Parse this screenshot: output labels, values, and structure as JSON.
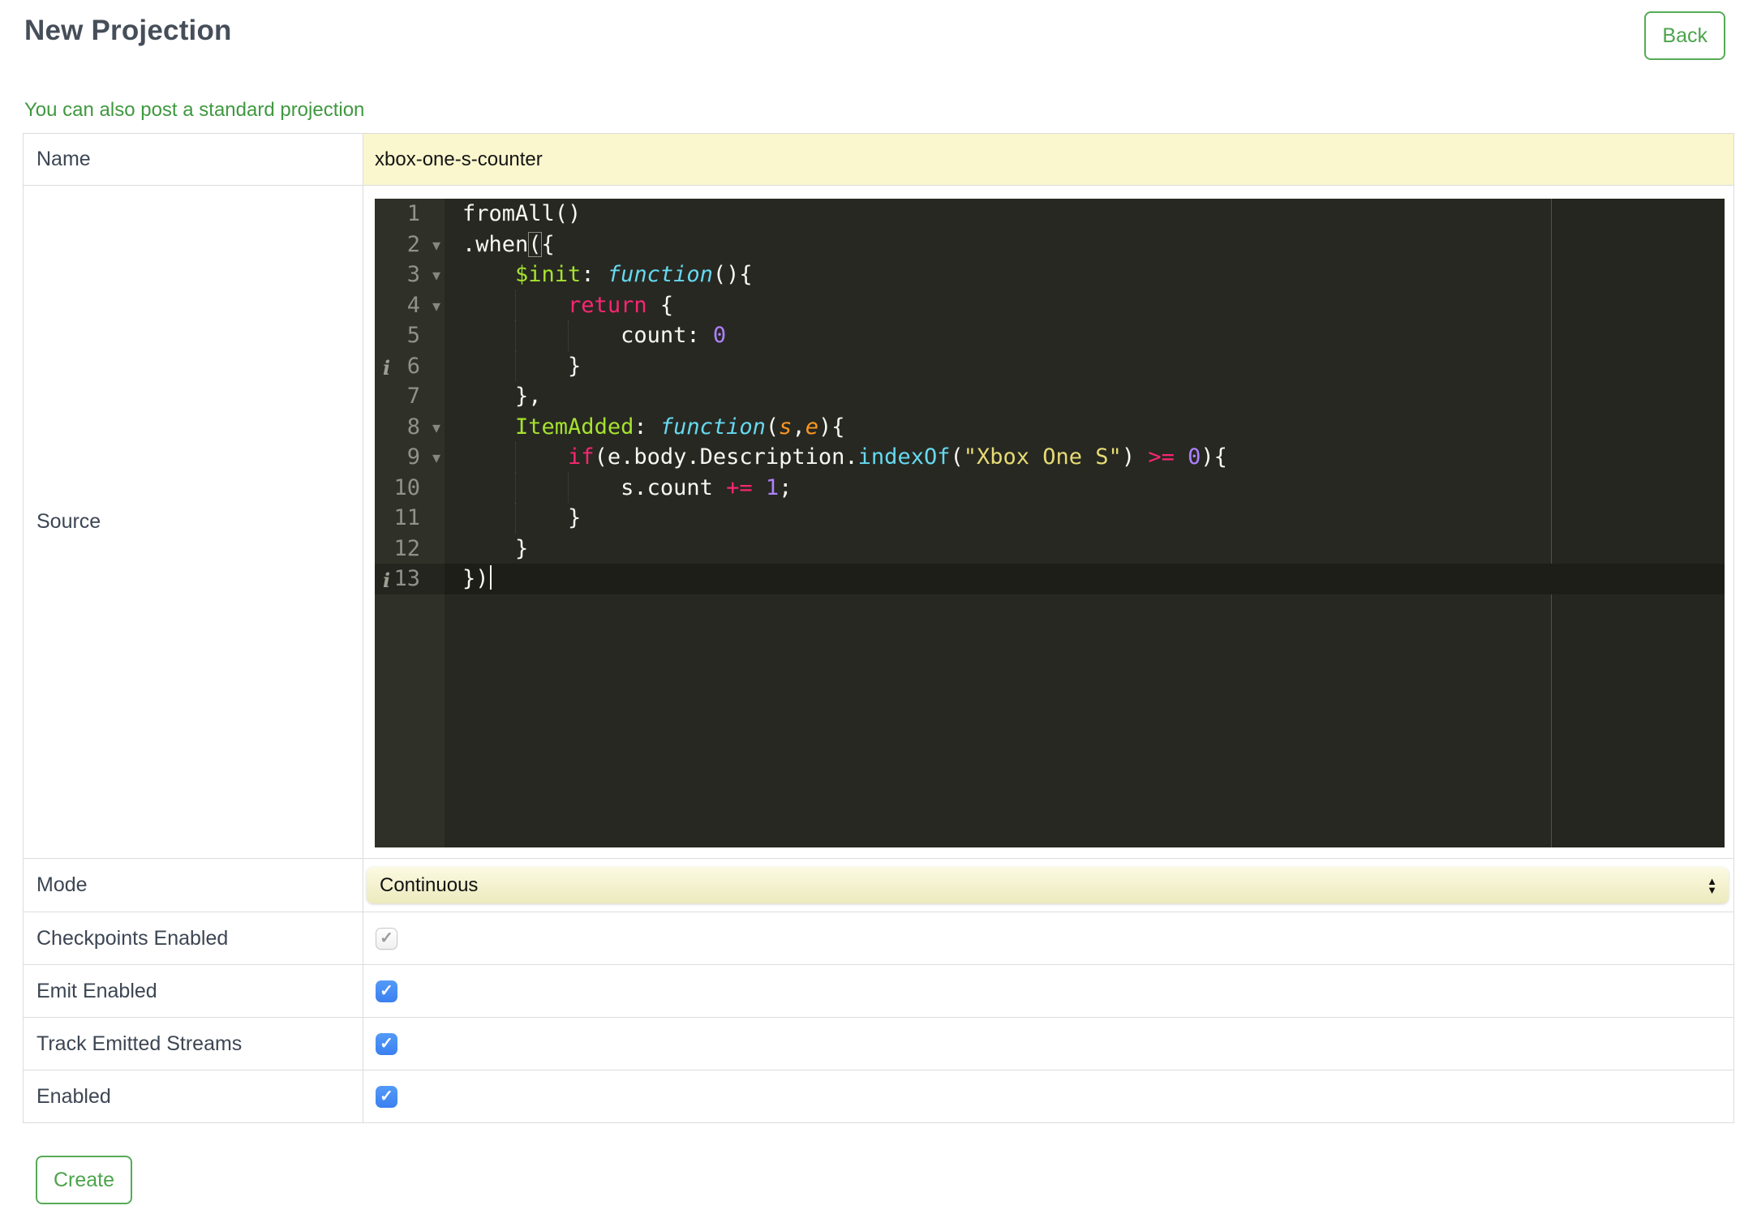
{
  "page": {
    "title": "New Projection",
    "back_label": "Back",
    "standard_projection_link": "You can also post a standard projection",
    "create_label": "Create"
  },
  "form": {
    "name": {
      "label": "Name",
      "value": "xbox-one-s-counter"
    },
    "source": {
      "label": "Source"
    },
    "mode": {
      "label": "Mode",
      "value": "Continuous"
    },
    "checkboxes": [
      {
        "label": "Checkpoints Enabled",
        "checked": true,
        "disabled": true
      },
      {
        "label": "Emit Enabled",
        "checked": true,
        "disabled": false
      },
      {
        "label": "Track Emitted Streams",
        "checked": true,
        "disabled": false
      },
      {
        "label": "Enabled",
        "checked": true,
        "disabled": false
      }
    ]
  },
  "icons": {
    "check": "✓",
    "select_arrow_up": "▲",
    "select_arrow_down": "▼",
    "fold_arrow": "▾",
    "info_marker": "i"
  },
  "colors": {
    "accent_green": "#4ca44c",
    "link_green": "#3f983f",
    "title_slate": "#454e59",
    "name_field_bg": "#faf6cd",
    "select_bg_top": "#fcfae2",
    "select_bg_bottom": "#eceabd",
    "checkbox_blue": "#3b80f0",
    "editor_bg": "#272822",
    "editor_gutter_bg": "#2f3129",
    "editor_text": "#f8f8f2",
    "editor_keyword": "#f92672",
    "editor_function": "#66d9ef",
    "editor_property": "#a6e22e",
    "editor_string": "#e6db74",
    "editor_number": "#ae81ff",
    "editor_param": "#fd971f"
  },
  "editor": {
    "lines": [
      {
        "n": 1,
        "tokens": [
          {
            "t": "fromAll()",
            "c": "plain"
          }
        ]
      },
      {
        "n": 2,
        "fold": true,
        "tokens": [
          {
            "t": ".when",
            "c": "plain"
          },
          {
            "t": "(",
            "c": "plain match"
          },
          {
            "t": "{",
            "c": "plain"
          }
        ]
      },
      {
        "n": 3,
        "fold": true,
        "tokens": [
          {
            "t": "    ",
            "c": "plain"
          },
          {
            "t": "$init",
            "c": "key"
          },
          {
            "t": ": ",
            "c": "plain"
          },
          {
            "t": "function",
            "c": "fn"
          },
          {
            "t": "(){",
            "c": "plain"
          }
        ]
      },
      {
        "n": 4,
        "fold": true,
        "tokens": [
          {
            "t": "        ",
            "c": "plain"
          },
          {
            "t": "return",
            "c": "kw"
          },
          {
            "t": " {",
            "c": "plain"
          }
        ]
      },
      {
        "n": 5,
        "tokens": [
          {
            "t": "            count: ",
            "c": "plain"
          },
          {
            "t": "0",
            "c": "num"
          }
        ]
      },
      {
        "n": 6,
        "info": true,
        "tokens": [
          {
            "t": "        }",
            "c": "plain"
          }
        ]
      },
      {
        "n": 7,
        "tokens": [
          {
            "t": "    },",
            "c": "plain"
          }
        ]
      },
      {
        "n": 8,
        "fold": true,
        "tokens": [
          {
            "t": "    ",
            "c": "plain"
          },
          {
            "t": "ItemAdded",
            "c": "key"
          },
          {
            "t": ": ",
            "c": "plain"
          },
          {
            "t": "function",
            "c": "fn"
          },
          {
            "t": "(",
            "c": "plain"
          },
          {
            "t": "s",
            "c": "param"
          },
          {
            "t": ",",
            "c": "plain"
          },
          {
            "t": "e",
            "c": "param"
          },
          {
            "t": "){",
            "c": "plain"
          }
        ]
      },
      {
        "n": 9,
        "fold": true,
        "tokens": [
          {
            "t": "        ",
            "c": "plain"
          },
          {
            "t": "if",
            "c": "kw"
          },
          {
            "t": "(e.body.Description.",
            "c": "plain"
          },
          {
            "t": "indexOf",
            "c": "support"
          },
          {
            "t": "(",
            "c": "plain"
          },
          {
            "t": "\"Xbox One S\"",
            "c": "str"
          },
          {
            "t": ") ",
            "c": "plain"
          },
          {
            "t": ">=",
            "c": "kw"
          },
          {
            "t": " ",
            "c": "plain"
          },
          {
            "t": "0",
            "c": "num"
          },
          {
            "t": "){",
            "c": "plain"
          }
        ]
      },
      {
        "n": 10,
        "tokens": [
          {
            "t": "            s.count ",
            "c": "plain"
          },
          {
            "t": "+=",
            "c": "kw"
          },
          {
            "t": " ",
            "c": "plain"
          },
          {
            "t": "1",
            "c": "num"
          },
          {
            "t": ";",
            "c": "plain"
          }
        ]
      },
      {
        "n": 11,
        "tokens": [
          {
            "t": "        }",
            "c": "plain"
          }
        ]
      },
      {
        "n": 12,
        "tokens": [
          {
            "t": "    }",
            "c": "plain"
          }
        ]
      },
      {
        "n": 13,
        "info": true,
        "active": true,
        "cursor": true,
        "tokens": [
          {
            "t": "})",
            "c": "plain"
          }
        ]
      }
    ]
  }
}
